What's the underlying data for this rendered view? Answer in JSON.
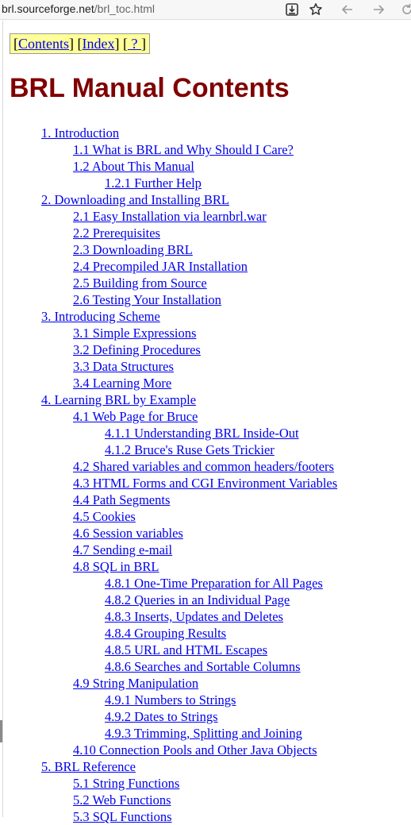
{
  "browser": {
    "url_host": "brl.sourceforge.net",
    "url_path": "/brl_toc.html"
  },
  "nav": {
    "contents": "Contents",
    "index": "Index",
    "help": " ? "
  },
  "page": {
    "title": "BRL Manual Contents"
  },
  "toc": [
    {
      "level": 1,
      "label": "1. Introduction"
    },
    {
      "level": 2,
      "label": "1.1 What is BRL and Why Should I Care?"
    },
    {
      "level": 2,
      "label": "1.2 About This Manual"
    },
    {
      "level": 3,
      "label": "1.2.1 Further Help"
    },
    {
      "level": 1,
      "label": "2. Downloading and Installing BRL"
    },
    {
      "level": 2,
      "label": "2.1 Easy Installation via learnbrl.war"
    },
    {
      "level": 2,
      "label": "2.2 Prerequisites"
    },
    {
      "level": 2,
      "label": "2.3 Downloading BRL"
    },
    {
      "level": 2,
      "label": "2.4 Precompiled JAR Installation"
    },
    {
      "level": 2,
      "label": "2.5 Building from Source"
    },
    {
      "level": 2,
      "label": "2.6 Testing Your Installation"
    },
    {
      "level": 1,
      "label": "3. Introducing Scheme"
    },
    {
      "level": 2,
      "label": "3.1 Simple Expressions"
    },
    {
      "level": 2,
      "label": "3.2 Defining Procedures"
    },
    {
      "level": 2,
      "label": "3.3 Data Structures"
    },
    {
      "level": 2,
      "label": "3.4 Learning More"
    },
    {
      "level": 1,
      "label": "4. Learning BRL by Example"
    },
    {
      "level": 2,
      "label": "4.1 Web Page for Bruce"
    },
    {
      "level": 3,
      "label": "4.1.1 Understanding BRL Inside-Out"
    },
    {
      "level": 3,
      "label": "4.1.2 Bruce's Ruse Gets Trickier"
    },
    {
      "level": 2,
      "label": "4.2 Shared variables and common headers/footers"
    },
    {
      "level": 2,
      "label": "4.3 HTML Forms and CGI Environment Variables"
    },
    {
      "level": 2,
      "label": "4.4 Path Segments"
    },
    {
      "level": 2,
      "label": "4.5 Cookies"
    },
    {
      "level": 2,
      "label": "4.6 Session variables"
    },
    {
      "level": 2,
      "label": "4.7 Sending e-mail"
    },
    {
      "level": 2,
      "label": "4.8 SQL in BRL"
    },
    {
      "level": 3,
      "label": "4.8.1 One-Time Preparation for All Pages"
    },
    {
      "level": 3,
      "label": "4.8.2 Queries in an Individual Page"
    },
    {
      "level": 3,
      "label": "4.8.3 Inserts, Updates and Deletes"
    },
    {
      "level": 3,
      "label": "4.8.4 Grouping Results"
    },
    {
      "level": 3,
      "label": "4.8.5 URL and HTML Escapes"
    },
    {
      "level": 3,
      "label": "4.8.6 Searches and Sortable Columns"
    },
    {
      "level": 2,
      "label": "4.9 String Manipulation"
    },
    {
      "level": 3,
      "label": "4.9.1 Numbers to Strings"
    },
    {
      "level": 3,
      "label": "4.9.2 Dates to Strings"
    },
    {
      "level": 3,
      "label": "4.9.3 Trimming, Splitting and Joining"
    },
    {
      "level": 2,
      "label": "4.10 Connection Pools and Other Java Objects"
    },
    {
      "level": 1,
      "label": "5. BRL Reference"
    },
    {
      "level": 2,
      "label": "5.1 String Functions"
    },
    {
      "level": 2,
      "label": "5.2 Web Functions"
    },
    {
      "level": 2,
      "label": "5.3 SQL Functions"
    }
  ]
}
